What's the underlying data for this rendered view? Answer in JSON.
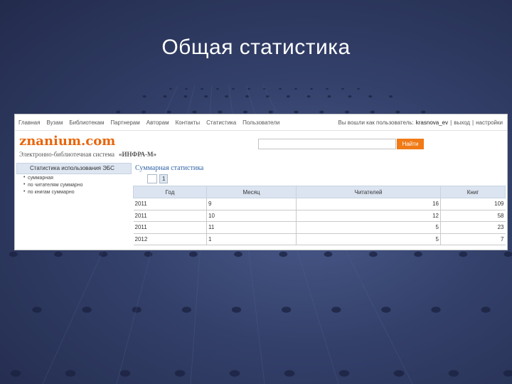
{
  "slide": {
    "title": "Общая статистика"
  },
  "nav": {
    "items": [
      "Главная",
      "Вузам",
      "Библиотекам",
      "Партнерам",
      "Авторам",
      "Контакты",
      "Статистика",
      "Пользователи"
    ],
    "user_prefix": "Вы вошли как пользователь:",
    "username": "krasnova_ev",
    "separator": "|",
    "logout": "выход",
    "settings": "настройки"
  },
  "brand": {
    "logo": "znanium.com",
    "subtitle": "Электронно-библиотечная система",
    "publisher": "«ИНФРА-М»"
  },
  "search": {
    "value": "",
    "button": "Найти"
  },
  "sidebar": {
    "heading": "Статистика использования ЭБС",
    "items": [
      "суммарная",
      "по читателям суммарно",
      "по книгам суммарно"
    ]
  },
  "main": {
    "title": "Суммарная статистика",
    "pager": {
      "current": "1"
    },
    "table": {
      "headers": [
        "Год",
        "Месяц",
        "Читателей",
        "Книг"
      ],
      "rows": [
        [
          "2011",
          "9",
          "16",
          "109"
        ],
        [
          "2011",
          "10",
          "12",
          "58"
        ],
        [
          "2011",
          "11",
          "5",
          "23"
        ],
        [
          "2012",
          "1",
          "5",
          "7"
        ]
      ]
    }
  },
  "colors": {
    "slide_background": "#33406a",
    "brand_orange": "#e8660c",
    "button_orange": "#f07a16",
    "header_fill": "#dbe4f0",
    "title_blue": "#3366a8"
  }
}
